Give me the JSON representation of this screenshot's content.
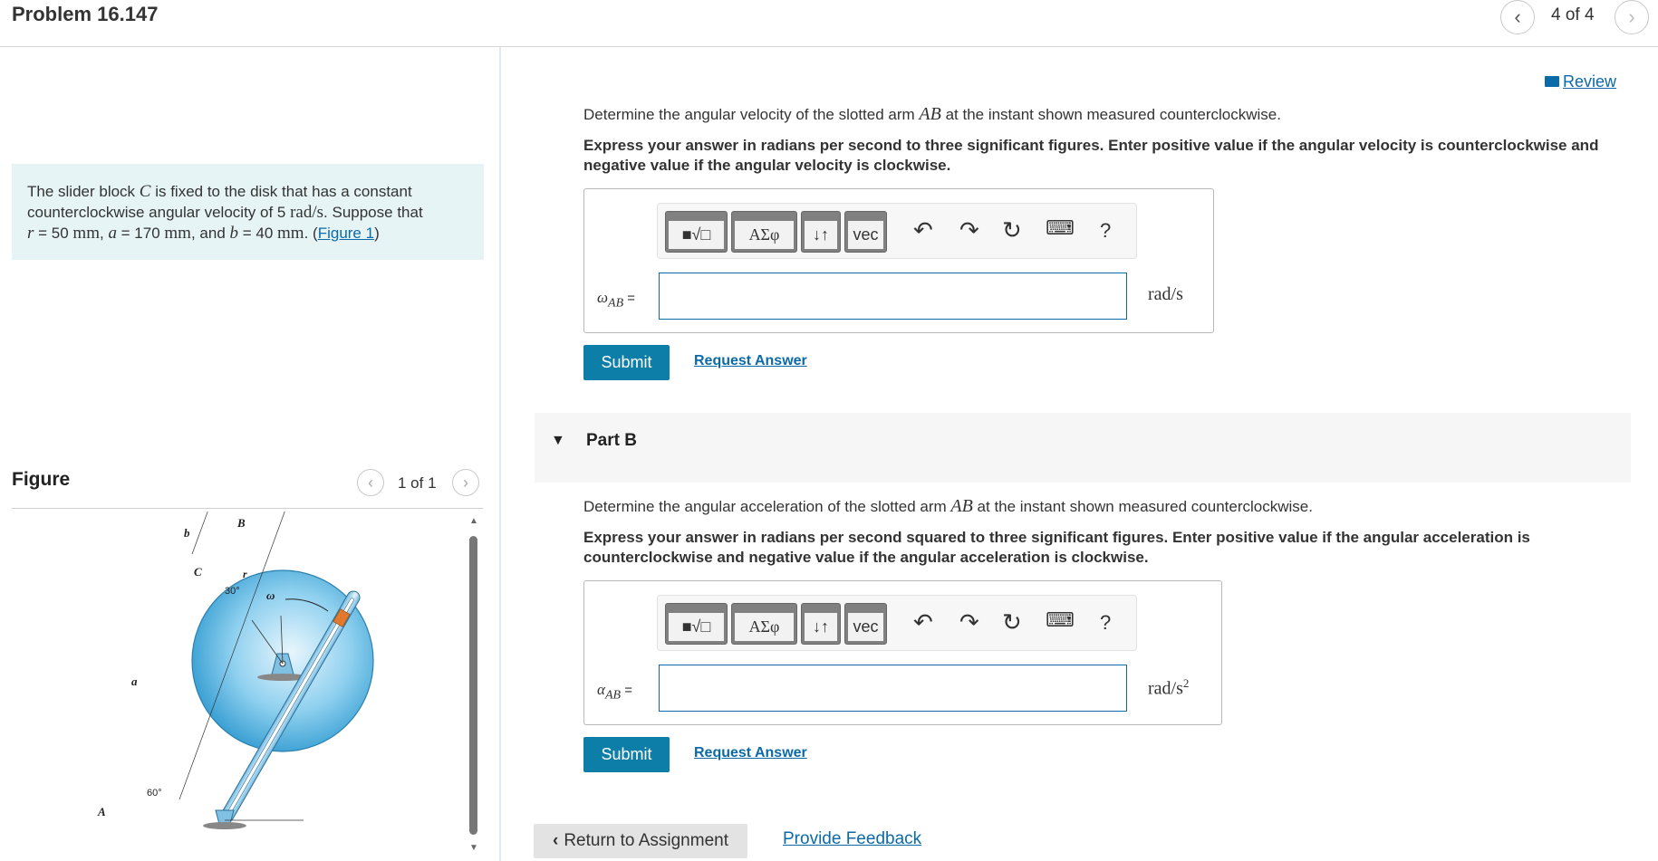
{
  "header": {
    "title": "Problem 16.147",
    "page_indicator": "4 of 4",
    "prev_icon": "chevron-left-icon",
    "next_icon": "chevron-right-icon"
  },
  "intro": {
    "line1_pre": "The slider block ",
    "line1_var": "C",
    "line1_post": " is fixed to the disk that has a constant",
    "line2_pre": "counterclockwise angular velocity of 5 ",
    "line2_unit": "rad/s",
    "line2_post": ". Suppose that",
    "line3_r": "r",
    "line3_r_val": " = 50 ",
    "line3_mm1": "mm",
    "line3_a": "a",
    "line3_a_val": " = 170 ",
    "line3_mm2": "mm",
    "line3_and": ", and ",
    "line3_b": "b",
    "line3_b_val": " = 40 ",
    "line3_mm3": "mm",
    "line3_end": ". (",
    "figure_link": "Figure 1",
    "close": ")"
  },
  "figure": {
    "label": "Figure",
    "count": "1 of 1",
    "labels": {
      "B": "B",
      "b": "b",
      "C": "C",
      "r": "r",
      "angle30": "30°",
      "omega": "ω",
      "a": "a",
      "angle60": "60°",
      "A": "A"
    }
  },
  "review": {
    "label": "Review",
    "icon": "book-icon"
  },
  "partA": {
    "question_pre": "Determine the angular velocity of the slotted arm ",
    "question_var": "AB",
    "question_post": " at the instant shown measured counterclockwise.",
    "instruction": "Express your answer in radians per second to three significant figures. Enter positive value if the angular velocity is counterclockwise and negative value if the angular velocity is clockwise.",
    "label_sym": "ω",
    "label_sub": "AB",
    "label_eq": " =",
    "input_value": "",
    "unit": "rad/s",
    "submit": "Submit",
    "request": "Request Answer"
  },
  "partB": {
    "title": "Part B",
    "question_pre": "Determine the angular acceleration of the slotted arm ",
    "question_var": "AB",
    "question_post": " at the instant shown measured counterclockwise.",
    "instruction": "Express your answer in radians per second squared to three significant figures. Enter positive value if the angular acceleration is counterclockwise and negative value if the angular acceleration is clockwise.",
    "label_sym": "α",
    "label_sub": "AB",
    "label_eq": " =",
    "input_value": "",
    "unit": "rad/s",
    "unit_exp": "2",
    "submit": "Submit",
    "request": "Request Answer"
  },
  "toolbar": {
    "templates": "templates-icon",
    "greek": "ΑΣφ",
    "arrows": "↓↑",
    "vec": "vec",
    "undo": "undo-icon",
    "redo": "redo-icon",
    "reset": "reset-icon",
    "keyboard": "keyboard-icon",
    "help": "?"
  },
  "footer": {
    "return": "Return to Assignment",
    "feedback": "Provide Feedback"
  },
  "colors": {
    "accent": "#0d7ea7",
    "link": "#0b6aa8",
    "intro_bg": "#e6f4f5",
    "disk": "#4fb2e2"
  }
}
